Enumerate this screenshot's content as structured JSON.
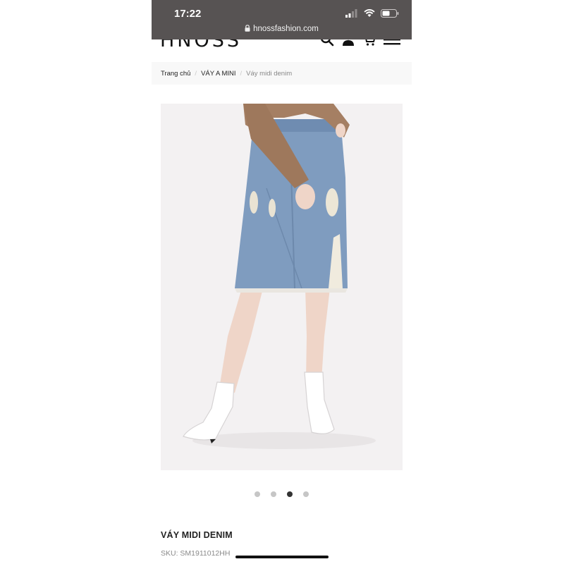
{
  "status_bar": {
    "time": "17:22",
    "url": "hnossfashion.com"
  },
  "header": {
    "logo": "HNOSS",
    "icons": [
      "search-icon",
      "user-icon",
      "cart-icon",
      "menu-icon"
    ]
  },
  "breadcrumb": {
    "items": [
      "Trang chủ",
      "VÁY A MINI",
      "Váy midi denim"
    ],
    "separator": "/"
  },
  "gallery": {
    "slide_count": 4,
    "active_index": 2
  },
  "product": {
    "title": "VÁY MIDI DENIM",
    "sku": "SKU: SM1911012HH"
  },
  "colors": {
    "status_bar_bg": "#575353",
    "denim": "#7f9cbf",
    "sweater": "#a57f63"
  }
}
